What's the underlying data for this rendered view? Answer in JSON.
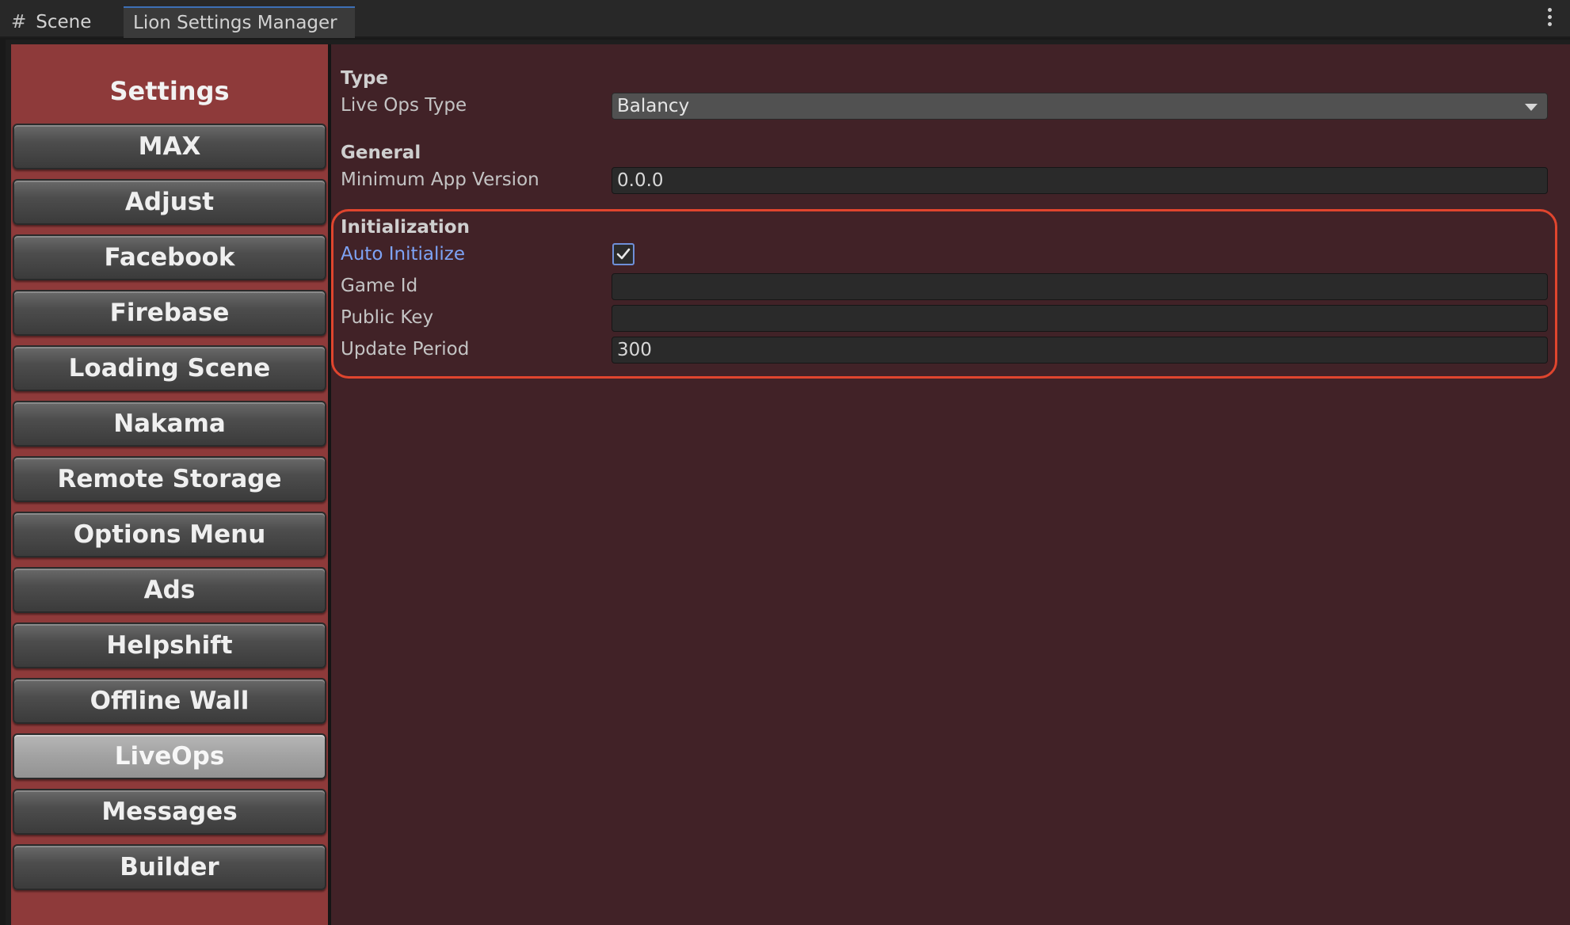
{
  "tabs": {
    "scene_label": "Scene",
    "active_label": "Lion Settings Manager"
  },
  "sidebar": {
    "title": "Settings",
    "buttons": [
      {
        "label": "MAX"
      },
      {
        "label": "Adjust"
      },
      {
        "label": "Facebook"
      },
      {
        "label": "Firebase"
      },
      {
        "label": "Loading Scene"
      },
      {
        "label": "Nakama"
      },
      {
        "label": "Remote Storage"
      },
      {
        "label": "Options Menu"
      },
      {
        "label": "Ads"
      },
      {
        "label": "Helpshift"
      },
      {
        "label": "Offline Wall"
      },
      {
        "label": "LiveOps"
      },
      {
        "label": "Messages"
      },
      {
        "label": "Builder"
      }
    ],
    "selected": "LiveOps"
  },
  "content": {
    "type_section": {
      "heading": "Type",
      "live_ops_type_label": "Live Ops Type",
      "live_ops_type_value": "Balancy"
    },
    "general_section": {
      "heading": "General",
      "min_app_version_label": "Minimum App Version",
      "min_app_version_value": "0.0.0"
    },
    "initialization_section": {
      "heading": "Initialization",
      "auto_initialize_label": "Auto Initialize",
      "auto_initialize_checked": true,
      "game_id_label": "Game Id",
      "game_id_value": "",
      "public_key_label": "Public Key",
      "public_key_value": "",
      "update_period_label": "Update Period",
      "update_period_value": "300"
    }
  },
  "colors": {
    "sidebar_bg": "#8e3a3a",
    "content_bg": "#412227",
    "highlight": "#e0452e",
    "link": "#7ea3f5"
  }
}
